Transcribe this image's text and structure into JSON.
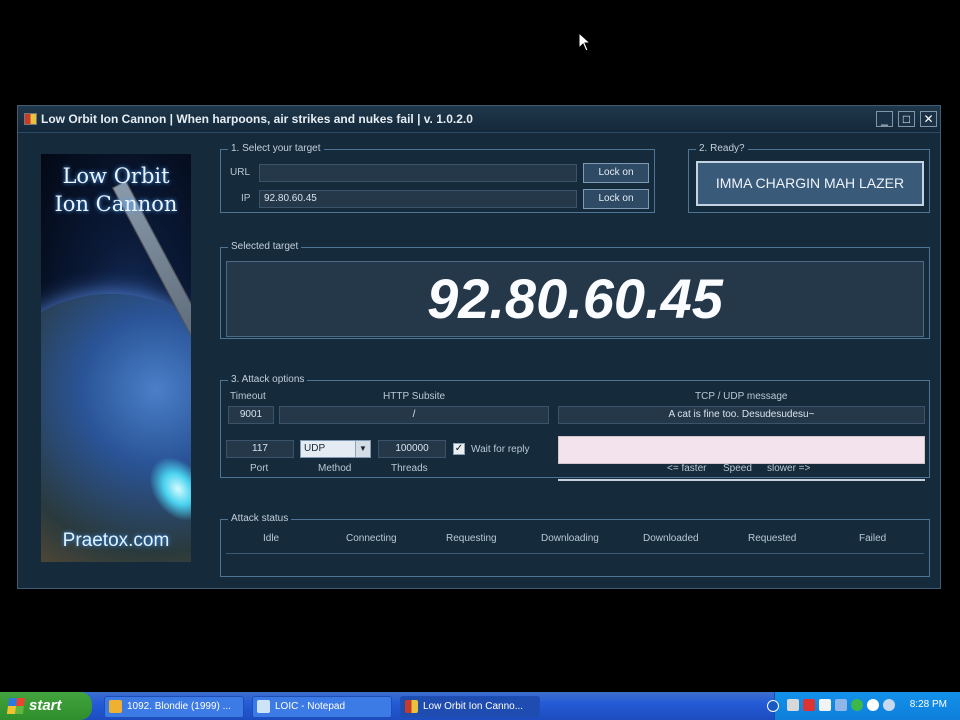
{
  "window": {
    "title": "Low Orbit Ion Cannon | When harpoons, air strikes and nukes fail | v. 1.0.2.0",
    "controls": {
      "minimize": "_",
      "maximize": "□",
      "close": "✕"
    }
  },
  "banner": {
    "logo_line1": "Low Orbit",
    "logo_line2": "Ion Cannon",
    "site": "Praetox.com"
  },
  "target_group": {
    "legend": "1. Select your target",
    "url_label": "URL",
    "url_value": "",
    "ip_label": "IP",
    "ip_value": "92.80.60.45",
    "lock_on_1": "Lock on",
    "lock_on_2": "Lock on"
  },
  "ready_group": {
    "legend": "2. Ready?",
    "fire_button": "IMMA CHARGIN MAH LAZER"
  },
  "selected_target": {
    "legend": "Selected target",
    "value": "92.80.60.45"
  },
  "attack_options": {
    "legend": "3. Attack options",
    "timeout_label": "Timeout",
    "timeout_value": "9001",
    "http_label": "HTTP Subsite",
    "http_value": "/",
    "tcp_label": "TCP / UDP message",
    "tcp_value": "A cat is fine too. Desudesudesu~",
    "port_value": "117",
    "port_label": "Port",
    "method_value": "UDP",
    "method_label": "Method",
    "threads_value": "100000",
    "threads_label": "Threads",
    "wait_reply_label": "Wait for reply",
    "wait_reply_checked": "✓",
    "speed_faster": "<= faster",
    "speed_label": "Speed",
    "speed_slower": "slower =>"
  },
  "attack_status": {
    "legend": "Attack status",
    "columns": [
      "Idle",
      "Connecting",
      "Requesting",
      "Downloading",
      "Downloaded",
      "Requested",
      "Failed"
    ]
  },
  "taskbar": {
    "start_label": "start",
    "tasks": [
      {
        "label": "1092. Blondie (1999) ..."
      },
      {
        "label": "LOIC - Notepad"
      },
      {
        "label": "Low Orbit Ion Canno..."
      }
    ],
    "clock": "8:28 PM"
  },
  "colors": {
    "window_bg": "#152a3b",
    "group_border": "#4f7596",
    "taskbar_blue": "#245bd6"
  }
}
